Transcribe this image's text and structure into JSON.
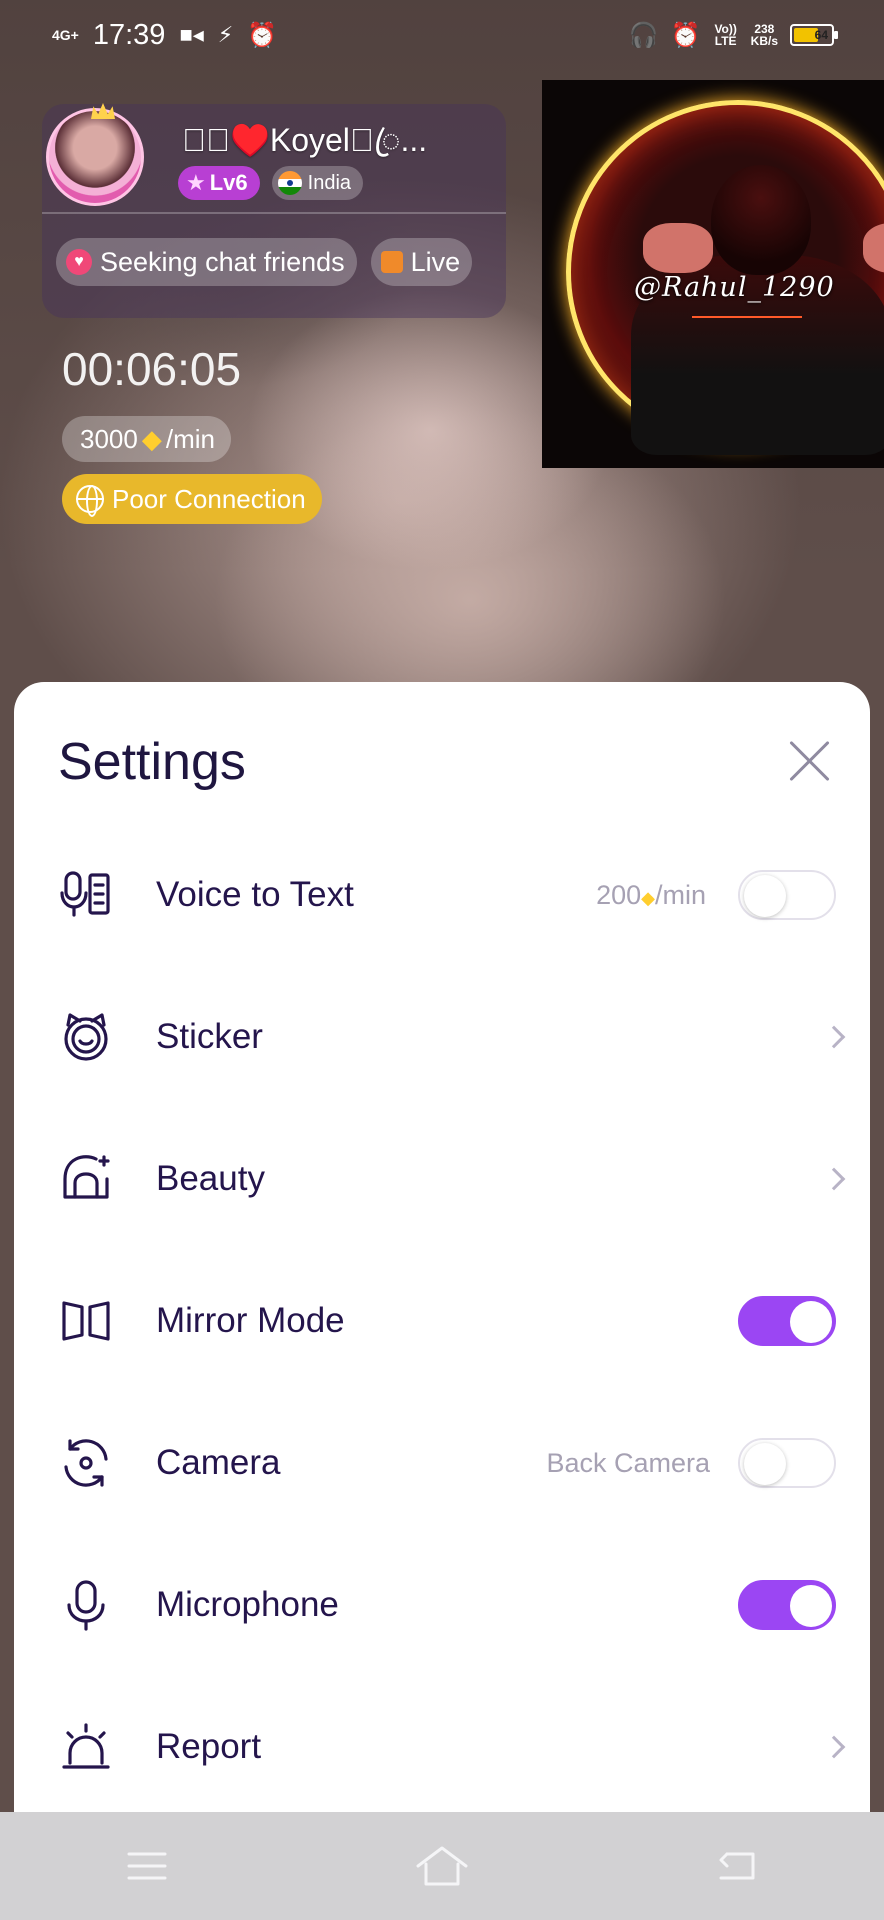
{
  "status_bar": {
    "network": "4G+",
    "time": "17:39",
    "volte": "Vo)) LTE",
    "speed_value": "238",
    "speed_unit": "KB/s",
    "battery": "64"
  },
  "caller": {
    "name": "ꦿ⃝♥️Koyel⃝ꦿ...",
    "level": "Lv6",
    "country": "India",
    "tags": [
      "Seeking chat friends",
      "Live"
    ]
  },
  "call": {
    "timer": "00:06:05",
    "rate_value": "3000",
    "rate_unit": "/min",
    "connection_status": "Poor Connection"
  },
  "pip": {
    "handle": "@Rahul_1290"
  },
  "settings": {
    "title": "Settings",
    "items": [
      {
        "label": "Voice to Text",
        "meta_value": "200",
        "meta_unit": "/min",
        "control": "toggle",
        "on": false
      },
      {
        "label": "Sticker",
        "control": "chevron"
      },
      {
        "label": "Beauty",
        "control": "chevron"
      },
      {
        "label": "Mirror Mode",
        "control": "toggle",
        "on": true
      },
      {
        "label": "Camera",
        "meta": "Back Camera",
        "control": "toggle",
        "on": false
      },
      {
        "label": "Microphone",
        "control": "toggle",
        "on": true
      },
      {
        "label": "Report",
        "control": "chevron"
      }
    ]
  },
  "colors": {
    "accent": "#9b46f3",
    "text_primary": "#24154c",
    "warning": "#e8b82b"
  },
  "icons": [
    "voice-to-text-icon",
    "sticker-icon",
    "beauty-icon",
    "mirror-icon",
    "camera-switch-icon",
    "microphone-icon",
    "report-alarm-icon",
    "close-icon",
    "chevron-right-icon",
    "menu-icon",
    "home-icon",
    "back-icon"
  ]
}
